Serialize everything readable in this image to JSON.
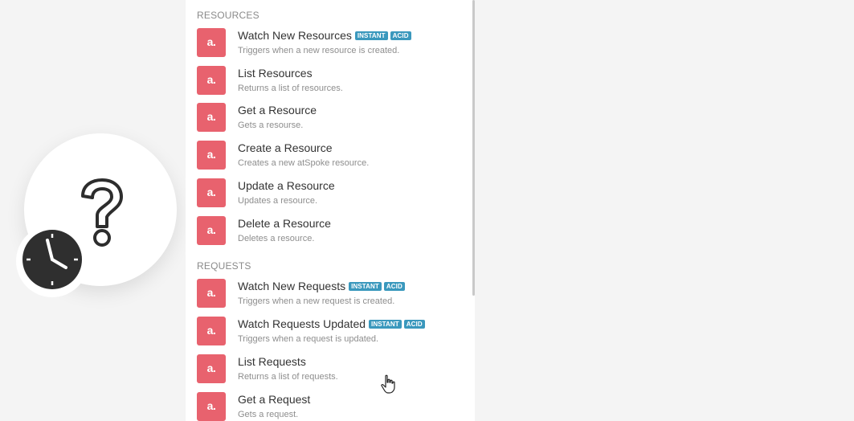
{
  "sections": [
    {
      "title": "RESOURCES",
      "items": [
        {
          "title": "Watch New Resources",
          "desc": "Triggers when a new resource is created.",
          "badges": [
            "INSTANT",
            "ACID"
          ]
        },
        {
          "title": "List Resources",
          "desc": "Returns a list of resources.",
          "badges": []
        },
        {
          "title": "Get a Resource",
          "desc": "Gets a resourse.",
          "badges": []
        },
        {
          "title": "Create a Resource",
          "desc": "Creates a new atSpoke resource.",
          "badges": []
        },
        {
          "title": "Update a Resource",
          "desc": "Updates a resource.",
          "badges": []
        },
        {
          "title": "Delete a Resource",
          "desc": "Deletes a resource.",
          "badges": []
        }
      ]
    },
    {
      "title": "REQUESTS",
      "items": [
        {
          "title": "Watch New Requests",
          "desc": "Triggers when a new request is created.",
          "badges": [
            "INSTANT",
            "ACID"
          ]
        },
        {
          "title": "Watch Requests Updated",
          "desc": "Triggers when a request is updated.",
          "badges": [
            "INSTANT",
            "ACID"
          ]
        },
        {
          "title": "List Requests",
          "desc": "Returns a list of requests.",
          "badges": []
        },
        {
          "title": "Get a Request",
          "desc": "Gets a request.",
          "badges": []
        }
      ]
    }
  ],
  "app_icon_glyph": "a.",
  "colors": {
    "app_icon": "#e8626e",
    "badge": "#3a98bd"
  },
  "icons": {
    "placeholder": "question-mark-icon",
    "schedule": "clock-icon",
    "pointer": "hand-cursor-icon"
  }
}
